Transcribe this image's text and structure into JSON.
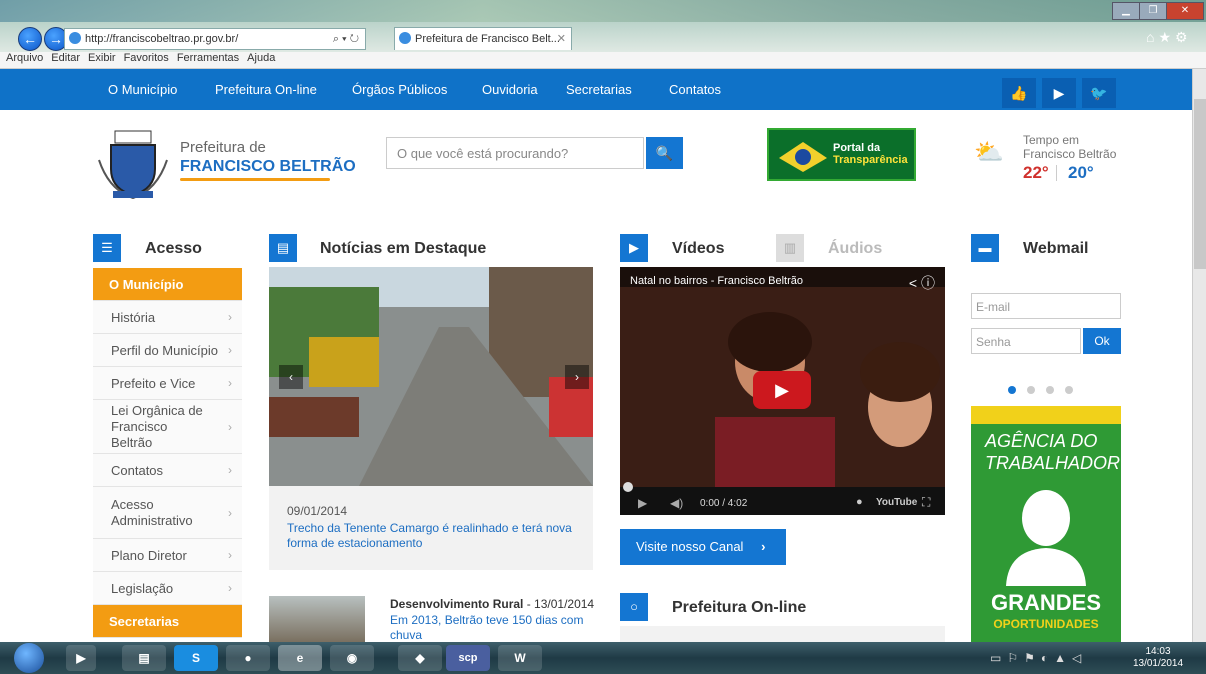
{
  "browser": {
    "url": "http://franciscobeltrao.pr.gov.br/",
    "address_controls": "⌕ ▾ ↻",
    "tab_title": "Prefeitura de Francisco Belt...",
    "menu": [
      "Arquivo",
      "Editar",
      "Exibir",
      "Favoritos",
      "Ferramentas",
      "Ajuda"
    ]
  },
  "nav": {
    "items": [
      "O Município",
      "Prefeitura On-line",
      "Órgãos Públicos",
      "Ouvidoria",
      "Secretarias",
      "Contatos"
    ]
  },
  "header": {
    "logo_line1": "Prefeitura de",
    "logo_line2": "FRANCISCO BELTRÃO",
    "search_placeholder": "O que você está procurando?",
    "portal_line1": "Portal da",
    "portal_line2": "Transparência",
    "weather_title1": "Tempo em",
    "weather_title2": "Francisco Beltrão",
    "temp_max": "22°",
    "temp_min": "20°"
  },
  "sidebar": {
    "title": "Acesso",
    "section1": "O Município",
    "items": [
      "História",
      "Perfil do Município",
      "Prefeito e Vice",
      "Lei Orgânica de Francisco Beltrão",
      "Contatos",
      "Acesso Administrativo",
      "Plano Diretor",
      "Legislação"
    ],
    "section2": "Secretarias"
  },
  "news": {
    "title": "Notícias em Destaque",
    "date": "09/01/2014",
    "headline": "Trecho da Tenente Camargo é realinhado e terá nova forma de estacionamento",
    "item2_category": "Desenvolvimento Rural",
    "item2_date": " - 13/01/2014",
    "item2_headline": "Em 2013, Beltrão teve 150 dias com chuva"
  },
  "media": {
    "videos_tab": "Vídeos",
    "audios_tab": "Áudios",
    "video_title": "Natal no bairros - Francisco Beltrão",
    "video_time": "0:00 / 4:02",
    "youtube": "YouTube",
    "visite_label": "Visite nosso Canal",
    "prefeitura_online": "Prefeitura On-line"
  },
  "webmail": {
    "title": "Webmail",
    "email_placeholder": "E-mail",
    "senha_placeholder": "Senha",
    "ok_label": "Ok",
    "banner_line1": "AGÊNCIA DO",
    "banner_line2": "TRABALHADOR",
    "banner_line3": "GRANDES",
    "banner_line4": "OPORTUNIDADES"
  },
  "taskbar": {
    "time": "14:03",
    "date": "13/01/2014",
    "apps": [
      "S",
      "scp"
    ]
  },
  "colors": {
    "nav_blue": "#0f72c8",
    "accent_orange": "#f39c12",
    "brand_green": "#2f9a35",
    "temp_red": "#d0312d"
  }
}
